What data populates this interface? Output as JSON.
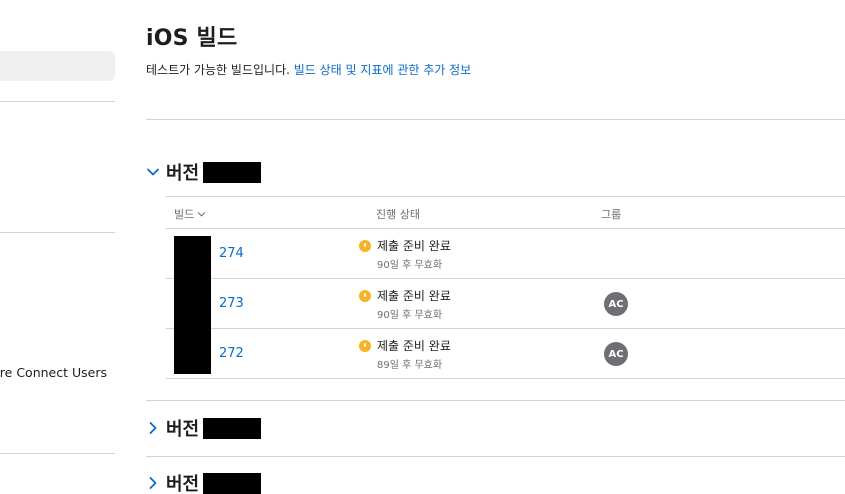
{
  "sidebar": {
    "partial_item_label": "ore Connect Users"
  },
  "page": {
    "title": "iOS 빌드",
    "subtitle_text": "테스트가 가능한 빌드입니다. ",
    "subtitle_link": "빌드 상태 및 지표에 관한 추가 정보"
  },
  "versions": [
    {
      "label": "버전",
      "expanded": true
    },
    {
      "label": "버전",
      "expanded": false
    },
    {
      "label": "버전",
      "expanded": false
    }
  ],
  "table": {
    "headers": {
      "build": "빌드",
      "status": "진행 상태",
      "group": "그룹"
    },
    "rows": [
      {
        "build": "274",
        "status": "제출 준비 완료",
        "expiry": "90일 후 무효화",
        "group": ""
      },
      {
        "build": "273",
        "status": "제출 준비 완료",
        "expiry": "90일 후 무효화",
        "group": "AC"
      },
      {
        "build": "272",
        "status": "제출 준비 완료",
        "expiry": "89일 후 무효화",
        "group": "AC"
      }
    ]
  },
  "colors": {
    "link": "#0b6bcb",
    "status_warning": "#f5b423",
    "avatar": "#6e6e73"
  }
}
